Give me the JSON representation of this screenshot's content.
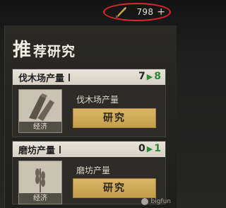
{
  "header": {
    "currency": {
      "icon": "quill-icon",
      "value": "798",
      "plus": "+"
    }
  },
  "section": {
    "title_big": "推",
    "title_rest": "荐研究"
  },
  "cards": [
    {
      "name": "伐木场产量",
      "level_current": "7",
      "level_next": "8",
      "category": "经济",
      "description": "伐木场产量",
      "button": "研究",
      "icon": "lumber-icon"
    },
    {
      "name": "磨坊产量",
      "level_current": "0",
      "level_next": "1",
      "category": "经济",
      "description": "磨坊产量",
      "button": "研究",
      "icon": "wheat-icon"
    }
  ],
  "watermark": "bigfun"
}
